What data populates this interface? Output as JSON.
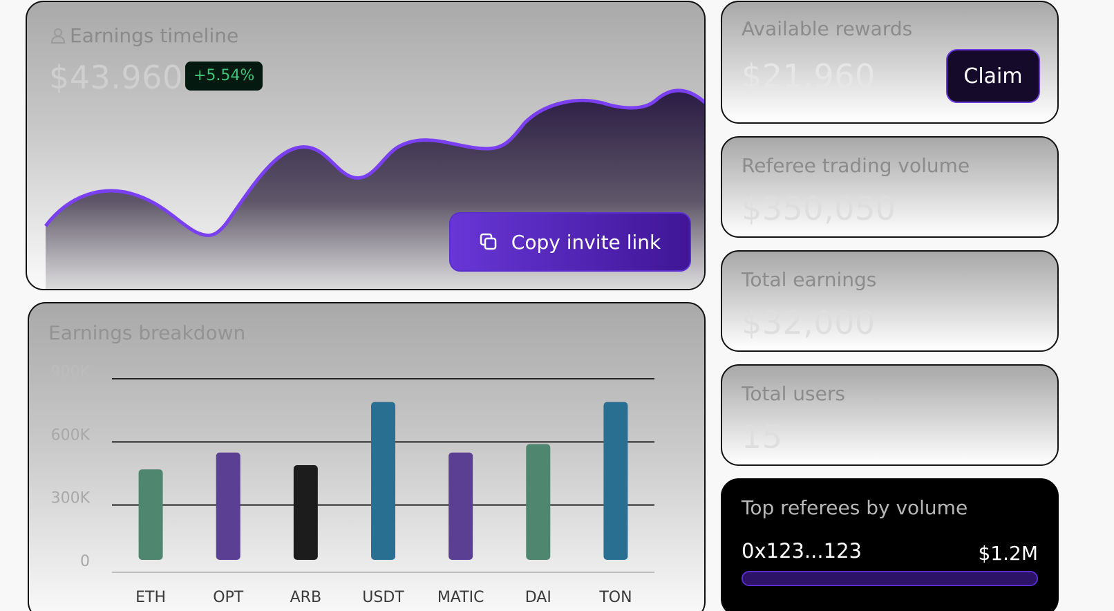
{
  "timeline": {
    "title": "Earnings timeline",
    "amount": "$43.960",
    "change": "+5.54%",
    "copy_label": "Copy invite link"
  },
  "breakdown": {
    "title": "Earnings breakdown"
  },
  "chart_data": {
    "type": "bar",
    "categories": [
      "ETH",
      "OPT",
      "ARB",
      "USDT",
      "MATIC",
      "DAI",
      "TON"
    ],
    "values": [
      430000,
      510000,
      450000,
      750000,
      510000,
      550000,
      750000
    ],
    "colors": [
      "#4e8670",
      "#5a3f93",
      "#1c1c1c",
      "#286f92",
      "#5a3f93",
      "#4e8670",
      "#286f92"
    ],
    "yticks": [
      "0",
      "300K",
      "600K",
      "900K"
    ],
    "ylim": [
      0,
      900000
    ],
    "grid": true
  },
  "rewards": {
    "title": "Available rewards",
    "value": "$21.960",
    "claim_label": "Claim"
  },
  "volume": {
    "title": "Referee trading volume",
    "value": "$350,050"
  },
  "earnings": {
    "title": "Total earnings",
    "value": "$32,000"
  },
  "users": {
    "title": "Total users",
    "value": "15"
  },
  "referees": {
    "title": "Top referees by volume",
    "items": [
      {
        "address": "0x123...123",
        "volume": "$1.2M",
        "share": 1.0
      }
    ]
  },
  "colors": {
    "accent": "#7b3ff2",
    "accent_dark": "#3f1696",
    "positive": "#3fc27a"
  }
}
